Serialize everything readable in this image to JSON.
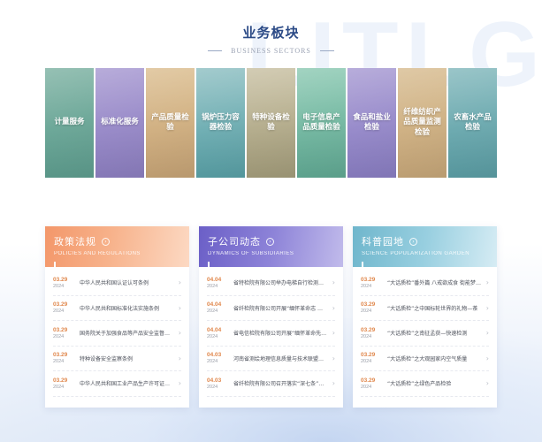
{
  "watermark": "LITLG",
  "section": {
    "title": "业务板块",
    "subtitle": "BUSINESS SECTORS"
  },
  "sectors": [
    {
      "label": "计量服务"
    },
    {
      "label": "标准化服务"
    },
    {
      "label": "产品质量检验"
    },
    {
      "label": "锅炉压力容器检验"
    },
    {
      "label": "特种设备检验"
    },
    {
      "label": "电子信息产品质量检验"
    },
    {
      "label": "食品和盐业检验"
    },
    {
      "label": "纤维纺织产品质量监测检验"
    },
    {
      "label": "农畜水产品检验"
    }
  ],
  "panels": [
    {
      "title": "政策法规",
      "subtitle": "POLICIES AND REGULATIONS",
      "items": [
        {
          "md": "03.29",
          "year": "2024",
          "title": "中华人民共和国认证认可条例"
        },
        {
          "md": "03.29",
          "year": "2024",
          "title": "中华人民共和国标准化法实施条例"
        },
        {
          "md": "03.29",
          "year": "2024",
          "title": "国务院关于加强食品等产品安全监督管理的特别规定"
        },
        {
          "md": "03.29",
          "year": "2024",
          "title": "特种设备安全监察条例"
        },
        {
          "md": "03.29",
          "year": "2024",
          "title": "中华人民共和国工业产品生产许可证管理条例"
        }
      ]
    },
    {
      "title": "子公司动态",
      "subtitle": "DYNAMICS OF SUBSIDIARIES",
      "items": [
        {
          "md": "04.04",
          "year": "2024",
          "title": "省特检院有限公司举办电梯自行检测技术培训"
        },
        {
          "md": "04.04",
          "year": "2024",
          "title": "省纤检院有限公司开展“缅怀革命志 共筑中国梦”主题活动"
        },
        {
          "md": "04.04",
          "year": "2024",
          "title": "省电信检院有限公司开展“缅怀革命先烈 传承红色基因”活动"
        },
        {
          "md": "04.03",
          "year": "2024",
          "title": "河南省测绘地理信息质量与技术联盟在郑州成立"
        },
        {
          "md": "04.03",
          "year": "2024",
          "title": "省纤检院有限公司召开落实“深七条”工作推进会"
        }
      ]
    },
    {
      "title": "科普园地",
      "subtitle": "SCIENCE POPULARIZATION GARDEN",
      "items": [
        {
          "md": "03.29",
          "year": "2024",
          "title": "“大话质检”番外篇 八戒欲成食 街能梦谭记"
        },
        {
          "md": "03.29",
          "year": "2024",
          "title": "“大话质检”之中国标轮世界的礼物—茶"
        },
        {
          "md": "03.29",
          "year": "2024",
          "title": "“大话质检”之南征孟获—快速检测"
        },
        {
          "md": "03.29",
          "year": "2024",
          "title": "“大话质检”之大观园家内空气质量"
        },
        {
          "md": "03.29",
          "year": "2024",
          "title": "“大话质检”之绿色产品检验"
        }
      ]
    }
  ]
}
